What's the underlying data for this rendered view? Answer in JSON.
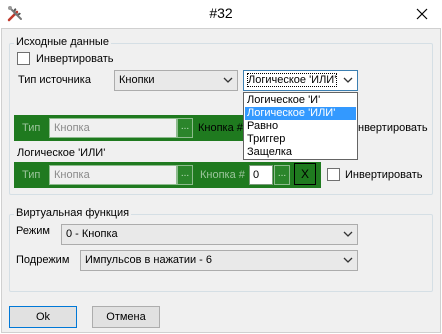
{
  "window": {
    "title": "#32"
  },
  "source_group": {
    "legend": "Исходные данные",
    "invert_label": "Инвертировать",
    "source_type_label": "Тип источника",
    "source_type_value": "Кнопки",
    "logic_value": "Логическое 'ИЛИ'",
    "logic_options": [
      "Логическое 'И'",
      "Логическое 'ИЛИ'",
      "Равно",
      "Триггер",
      "Защелка"
    ],
    "logic_selected_index": 1
  },
  "row1": {
    "type_label": "Тип",
    "type_placeholder": "Кнопка",
    "button_num_label": "Кнопка #",
    "invert_label": "Инвертировать"
  },
  "logic_section_label": "Логическое 'ИЛИ'",
  "row2": {
    "type_label": "Тип",
    "type_placeholder": "Кнопка",
    "button_num_label": "Кнопка #",
    "button_num_value": "0",
    "x_label": "X",
    "invert_label": "Инвертировать"
  },
  "virtual_group": {
    "legend": "Виртуальная функция",
    "mode_label": "Режим",
    "mode_value": "0 - Кнопка",
    "submode_label": "Подрежим",
    "submode_value": "Импульсов в нажатии - 6"
  },
  "buttons": {
    "ok": "Ok",
    "cancel": "Отмена"
  },
  "icons": {
    "app": "tools-icon",
    "close": "close-icon",
    "arrow": "chevron-down-icon"
  },
  "colors": {
    "green_panel": "#1f7a1f",
    "selection": "#3399ff"
  }
}
